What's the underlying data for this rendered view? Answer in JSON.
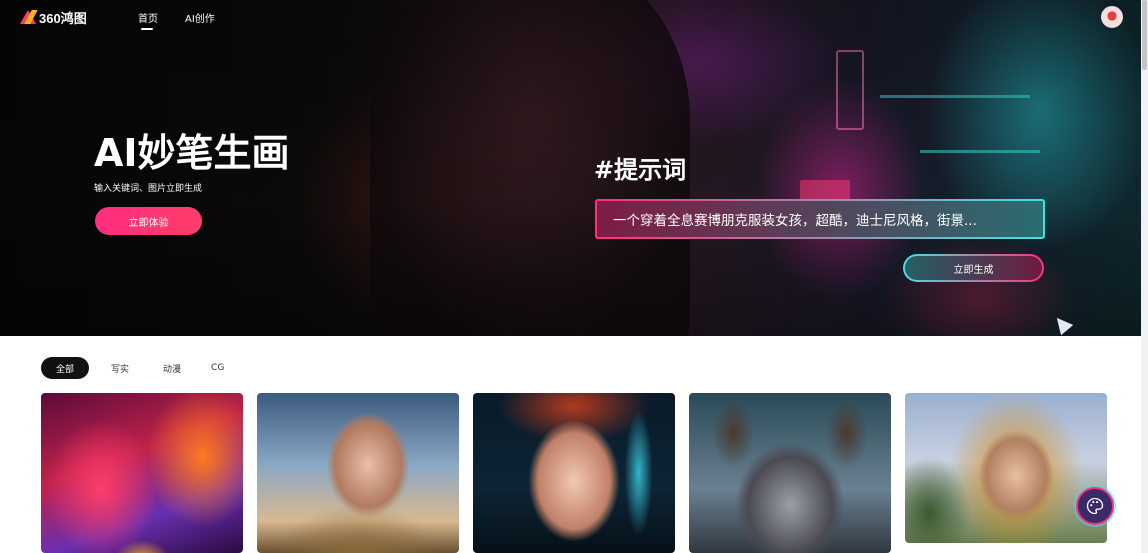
{
  "nav": {
    "logo_text": "360鸿图",
    "items": [
      {
        "label": "首页",
        "active": true
      },
      {
        "label": "AI创作",
        "active": false
      }
    ]
  },
  "hero": {
    "title": "AI妙笔生画",
    "subtitle": "输入关键词、图片立即生成",
    "try_button": "立即体验",
    "prompt_title": "#提示词",
    "prompt_text": "一个穿着全息赛博朋克服装女孩，超酷，迪士尼风格，街景...",
    "generate_button": "立即生成"
  },
  "filters": {
    "tabs": [
      {
        "label": "全部",
        "active": true
      },
      {
        "label": "写实",
        "active": false
      },
      {
        "label": "动漫",
        "active": false
      },
      {
        "label": "CG",
        "active": false
      }
    ]
  },
  "gallery": {
    "cards": [
      {
        "subject": "neon-fox"
      },
      {
        "subject": "fantasy-woman-portrait"
      },
      {
        "subject": "cyber-woman-portrait"
      },
      {
        "subject": "wolf"
      },
      {
        "subject": "fox-armor-woman"
      }
    ]
  },
  "colors": {
    "accent_pink": "#ff2e7e",
    "accent_cyan": "#45e0e0",
    "tab_active_bg": "#111111"
  },
  "icons": {
    "floating_assistant": "palette-icon",
    "avatar": "user-avatar",
    "cursor": "cursor-icon"
  }
}
